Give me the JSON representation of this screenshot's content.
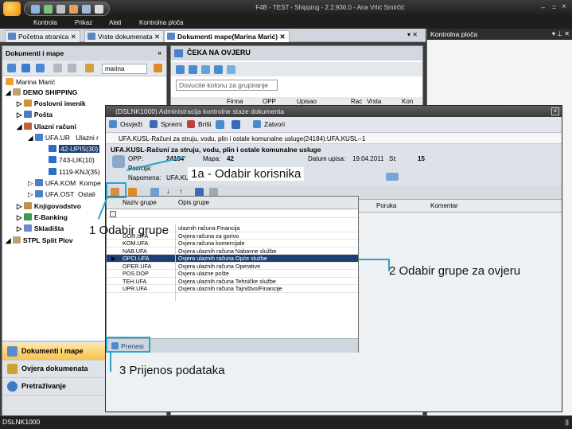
{
  "window": {
    "title": "F4B - TEST - Shipping - 2.2.936.0 - Ana  Vrlić Smirčić"
  },
  "menu": [
    "Kontrola",
    "Prikaz",
    "Alati",
    "Kontrolna ploča"
  ],
  "tabs": [
    {
      "label": "Početna stranica"
    },
    {
      "label": "Vrste dokumenata"
    },
    {
      "label": "Dokumenti mape(Marina Marić)"
    }
  ],
  "right_panel": {
    "title": "Kontrolna ploča"
  },
  "left_panel": {
    "title": "Dokumenti i mape",
    "search": "marina",
    "tree": {
      "user": "Marina Marić",
      "company": "DEMO SHIPPING",
      "n1": "Poslovni imenik",
      "n2": "Pošta",
      "n3": "Ulazni računi",
      "n4": "UFA.UR",
      "n4b": "Ulazni r",
      "n5": "42-UPIS(30)",
      "n6": "743-LIK(10)",
      "n7": "1119-KNJ(35)",
      "n8": "UFA.KOM",
      "n8b": "Kompe",
      "n9": "UFA.OST",
      "n9b": "Ostali",
      "n10": "Knjigovodstvo",
      "n11": "E-Banking",
      "n12": "Skladišta",
      "n13": "STPL Split Plov"
    },
    "nav": [
      "Dokumenti i mape",
      "Ovjera dokumenata",
      "Pretraživanje"
    ]
  },
  "center": {
    "title": "ČEKA NA OVJERU",
    "group_hint": "Dovucite kolonu za grupiranje",
    "cols": [
      "Firma",
      "OPP",
      "Upisao",
      "Rac",
      "Vrsta",
      "Kon"
    ]
  },
  "dialog": {
    "title": "(DSLNK1000) Administracija kontrolne staze dokumenta",
    "toolbar": [
      "Osvježi",
      "Spremi",
      "Briši",
      "Zatvori"
    ],
    "path": "UFA.KUSL-Računi za struju, vodu, plin i ostale komunalne usluge(24184):UFA.KUSL--1",
    "heading": "UFA.KUSL-Računi za struju, vodu, plin i ostale komunalne usluge",
    "opp_label": "OPP:",
    "opp": "24184",
    "mapa_label": "Mapa:",
    "mapa": "42",
    "datum_label": "Datum upisa:",
    "datum": "19.04.2011",
    "st_label": "St:",
    "st": "15",
    "pozicija_label": "Pozicija:",
    "napomena_label": "Napomena:",
    "napomena": "UFA.KU",
    "cols": [
      "Poruka",
      "Komentar"
    ]
  },
  "popup": {
    "col1": "Naziv grupe",
    "col2": "Opis grupe",
    "rows": [
      {
        "code": "",
        "desc": "ulaznih računa Financija"
      },
      {
        "code": "GOR.UFA",
        "desc": "Ovjera računa za gorivo"
      },
      {
        "code": "KOM.UFA",
        "desc": "Ovjera računa komercijale"
      },
      {
        "code": "NAB.UFA",
        "desc": "Ovjera ulaznih računa Nabavne službe"
      },
      {
        "code": "OPCI.UFA",
        "desc": "Ovjera ulaznih računa Opće službe"
      },
      {
        "code": "OPER.UFA",
        "desc": "Ovjera ulaznih računa Operative"
      },
      {
        "code": "POS.DOP",
        "desc": "Ovjera ulazne pošte"
      },
      {
        "code": "TEH.UFA",
        "desc": "Ovjera ulaznih računa Tehničke službe"
      },
      {
        "code": "UPR.UFA",
        "desc": "Ovjera ulaznih računa Tajništvo/Financije"
      }
    ],
    "transfer": "Prenesi"
  },
  "annotations": {
    "a1a": "1a - Odabir korisnika",
    "a1": "1 Odabir grupe",
    "a2": "2 Odabir grupe za ovjeru",
    "a3": "3 Prijenos podataka"
  },
  "status": {
    "left": "DSLNK1000",
    "right": "||"
  }
}
